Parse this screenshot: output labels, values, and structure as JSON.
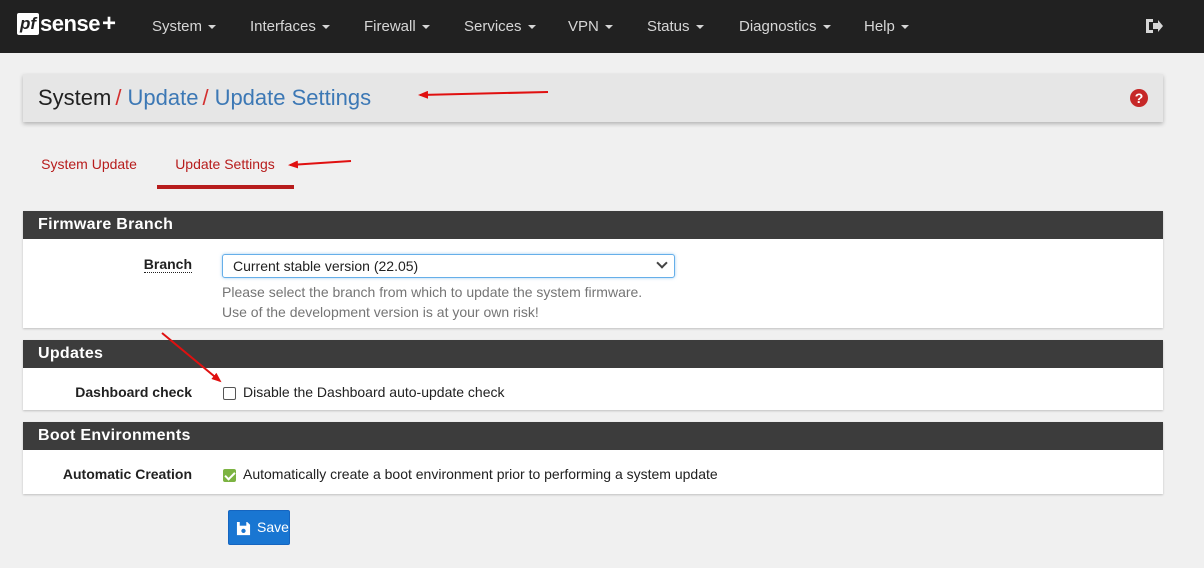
{
  "navbar": {
    "logo": {
      "pf": "pf",
      "sense": "sense",
      "plus": "+"
    },
    "items": [
      {
        "label": "System"
      },
      {
        "label": "Interfaces"
      },
      {
        "label": "Firewall"
      },
      {
        "label": "Services"
      },
      {
        "label": "VPN"
      },
      {
        "label": "Status"
      },
      {
        "label": "Diagnostics"
      },
      {
        "label": "Help"
      }
    ],
    "logout_icon": "sign-out-icon"
  },
  "breadcrumb": {
    "items": [
      {
        "label": "System"
      },
      {
        "label": "Update"
      },
      {
        "label": "Update Settings"
      }
    ],
    "separator": "/",
    "help_icon": "question-circle-icon",
    "help_glyph": "?"
  },
  "tabs": [
    {
      "label": "System Update",
      "active": false
    },
    {
      "label": "Update Settings",
      "active": true
    }
  ],
  "firmware_branch": {
    "heading": "Firmware Branch",
    "branch_label": "Branch",
    "branch_value": "Current stable version (22.05)",
    "help_line1": "Please select the branch from which to update the system firmware.",
    "help_line2": "Use of the development version is at your own risk!"
  },
  "updates": {
    "heading": "Updates",
    "dashboard_label": "Dashboard check",
    "dashboard_checkbox_label": "Disable the Dashboard auto-update check",
    "dashboard_checked": false
  },
  "boot_environments": {
    "heading": "Boot Environments",
    "auto_label": "Automatic Creation",
    "auto_checkbox_label": "Automatically create a boot environment prior to performing a system update",
    "auto_checked": true
  },
  "save_button": {
    "label": "Save",
    "icon": "floppy-disk-icon"
  },
  "colors": {
    "navbar_bg": "#212121",
    "accent_red": "#b71c1c",
    "link_blue": "#3c78b5",
    "panel_heading_bg": "#3c3c3c",
    "save_blue": "#1976d2",
    "check_green": "#7cb342"
  }
}
